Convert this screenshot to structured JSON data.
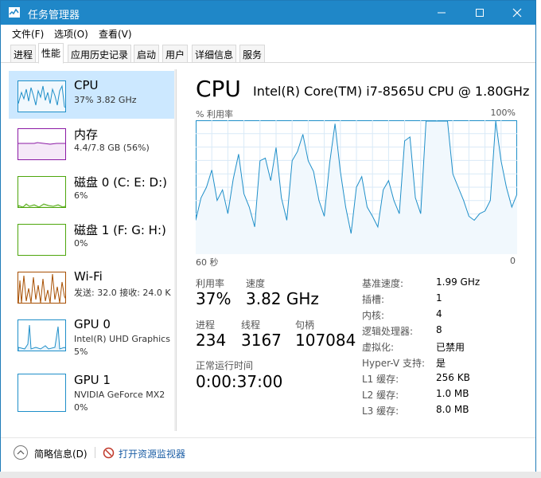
{
  "window": {
    "title": "任务管理器",
    "controls": [
      "minimize-icon",
      "maximize-icon",
      "close-icon"
    ]
  },
  "menu": {
    "file": "文件(F)",
    "options": "选项(O)",
    "view": "查看(V)"
  },
  "tabs": [
    {
      "label": "进程",
      "active": false
    },
    {
      "label": "性能",
      "active": true
    },
    {
      "label": "应用历史记录",
      "active": false
    },
    {
      "label": "启动",
      "active": false
    },
    {
      "label": "用户",
      "active": false
    },
    {
      "label": "详细信息",
      "active": false
    },
    {
      "label": "服务",
      "active": false
    }
  ],
  "sidebar": {
    "items": [
      {
        "title": "CPU",
        "sub": "37%  3.82 GHz",
        "color": "#1f8fc9",
        "selected": true
      },
      {
        "title": "内存",
        "sub": "4.4/7.8 GB (56%)",
        "color": "#8b1aa5",
        "selected": false
      },
      {
        "title": "磁盘 0 (C: E: D:)",
        "sub": "6%",
        "color": "#4da60c",
        "selected": false
      },
      {
        "title": "磁盘 1 (F: G: H:)",
        "sub": "0%",
        "color": "#4da60c",
        "selected": false
      },
      {
        "title": "Wi-Fi",
        "sub": "发送: 32.0  接收: 24.0 K",
        "color": "#a74f01",
        "selected": false
      },
      {
        "title": "GPU 0",
        "sub": "Intel(R) UHD Graphics",
        "sub2": "5%",
        "color": "#1f8fc9",
        "selected": false
      },
      {
        "title": "GPU 1",
        "sub": "NVIDIA GeForce MX2",
        "sub2": "0%",
        "color": "#1f8fc9",
        "selected": false
      }
    ]
  },
  "main": {
    "title": "CPU",
    "model": "Intel(R) Core(TM) i7-8565U CPU @ 1.80GHz",
    "graph_top_left": "% 利用率",
    "graph_top_right": "100%",
    "graph_bottom_left": "60 秒",
    "graph_bottom_right": "0",
    "stats": {
      "utilization_label": "利用率",
      "utilization_value": "37%",
      "speed_label": "速度",
      "speed_value": "3.82 GHz",
      "processes_label": "进程",
      "processes_value": "234",
      "threads_label": "线程",
      "threads_value": "3167",
      "handles_label": "句柄",
      "handles_value": "107084",
      "uptime_label": "正常运行时间",
      "uptime_value": "0:00:37:00"
    },
    "details": [
      {
        "label": "基准速度:",
        "value": "1.99 GHz"
      },
      {
        "label": "插槽:",
        "value": "1"
      },
      {
        "label": "内核:",
        "value": "4"
      },
      {
        "label": "逻辑处理器:",
        "value": "8"
      },
      {
        "label": "虚拟化:",
        "value": "已禁用"
      },
      {
        "label": "Hyper-V 支持:",
        "value": "是"
      },
      {
        "label": "L1 缓存:",
        "value": "256 KB"
      },
      {
        "label": "L2 缓存:",
        "value": "1.0 MB"
      },
      {
        "label": "L3 缓存:",
        "value": "8.0 MB"
      }
    ]
  },
  "footer": {
    "fewer_details": "简略信息(D)",
    "open_monitor": "打开资源监视器"
  },
  "chart_data": {
    "type": "area",
    "title": "",
    "ylabel": "% 利用率",
    "ylim": [
      0,
      100
    ],
    "xlim": [
      60,
      0
    ],
    "xlabel": "60 秒",
    "grid": true,
    "series": [
      {
        "values": [
          25,
          42,
          50,
          63,
          40,
          48,
          30,
          56,
          75,
          45,
          35,
          20,
          70,
          72,
          55,
          80,
          42,
          25,
          70,
          77,
          90,
          70,
          62,
          40,
          28,
          68,
          98,
          62,
          35,
          15,
          50,
          58,
          35,
          28,
          20,
          48,
          55,
          40,
          30,
          85,
          88,
          42,
          30,
          100,
          100,
          100,
          100,
          100,
          60,
          50,
          40,
          28,
          25,
          30,
          32,
          40,
          100,
          70,
          50,
          35,
          45
        ]
      }
    ],
    "color": "#1f8fc9"
  }
}
